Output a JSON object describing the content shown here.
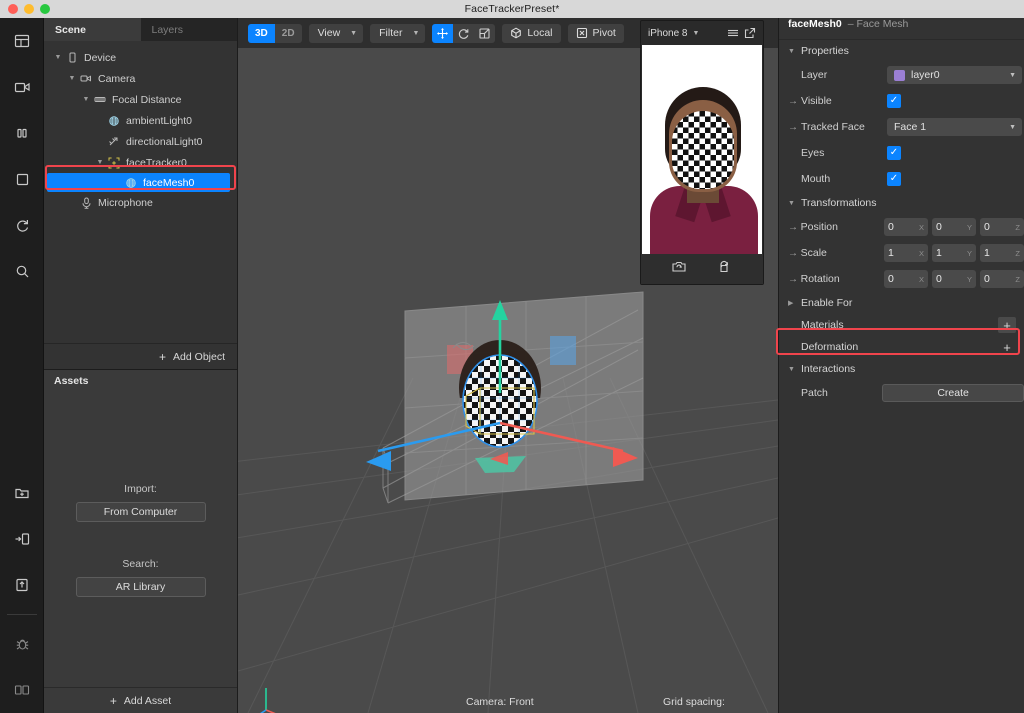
{
  "window": {
    "title": "FaceTrackerPreset*"
  },
  "rail": {
    "top": [
      {
        "icon": "layout-icon",
        "name": "rail-layout"
      },
      {
        "icon": "video-camera-icon",
        "name": "rail-video"
      },
      {
        "icon": "pause-icon",
        "name": "rail-pause"
      },
      {
        "icon": "stop-square-icon",
        "name": "rail-stop"
      },
      {
        "icon": "refresh-icon",
        "name": "rail-refresh"
      },
      {
        "icon": "search-icon",
        "name": "rail-search"
      }
    ],
    "bottom": [
      {
        "icon": "folder-plus-icon",
        "name": "rail-new-folder"
      },
      {
        "icon": "send-to-device-icon",
        "name": "rail-send-device"
      },
      {
        "icon": "upload-icon",
        "name": "rail-upload"
      },
      {
        "icon": "bug-icon",
        "name": "rail-debug"
      },
      {
        "icon": "panels-icon",
        "name": "rail-panels"
      }
    ]
  },
  "scene_panel": {
    "tabs": [
      {
        "label": "Scene",
        "active": true
      },
      {
        "label": "Layers",
        "active": false
      }
    ],
    "tree": [
      {
        "label": "Device",
        "depth": 0,
        "twist": "down",
        "icon": "device-icon",
        "selected": false
      },
      {
        "label": "Camera",
        "depth": 1,
        "twist": "down",
        "icon": "camera-icon",
        "selected": false
      },
      {
        "label": "Focal Distance",
        "depth": 2,
        "twist": "down",
        "icon": "focal-icon",
        "selected": false
      },
      {
        "label": "ambientLight0",
        "depth": 3,
        "twist": "",
        "icon": "ambient-light-icon",
        "selected": false
      },
      {
        "label": "directionalLight0",
        "depth": 3,
        "twist": "",
        "icon": "directional-light-icon",
        "selected": false
      },
      {
        "label": "faceTracker0",
        "depth": 3,
        "twist": "down",
        "icon": "face-tracker-icon",
        "selected": false
      },
      {
        "label": "faceMesh0",
        "depth": 4,
        "twist": "",
        "icon": "face-mesh-icon",
        "selected": true
      },
      {
        "label": "Microphone",
        "depth": 1,
        "twist": "",
        "icon": "microphone-icon",
        "selected": false
      }
    ],
    "add_object": "Add Object",
    "assets": {
      "title": "Assets",
      "import_label": "Import:",
      "import_button": "From Computer",
      "search_label": "Search:",
      "search_button": "AR Library",
      "add_asset": "Add Asset"
    }
  },
  "viewport": {
    "toolbar": {
      "mode_3d": "3D",
      "mode_2d": "2D",
      "view": "View",
      "filter": "Filter",
      "local": "Local",
      "pivot": "Pivot",
      "tools": [
        "move-tool-icon",
        "rotate-tool-icon",
        "scale-tool-icon"
      ]
    },
    "status": {
      "camera": "Camera: Front",
      "grid": "Grid spacing:"
    }
  },
  "preview": {
    "device": "iPhone 8",
    "menu_icon": "hamburger-icon",
    "popout_icon": "external-link-icon",
    "foot": [
      "camera-flip-icon",
      "record-rotate-icon"
    ]
  },
  "inspector": {
    "object_name": "faceMesh0",
    "object_type": "– Face Mesh",
    "sections": {
      "properties": "Properties",
      "transformations": "Transformations",
      "enable_for": "Enable For",
      "materials": "Materials",
      "deformation": "Deformation",
      "interactions": "Interactions"
    },
    "properties": {
      "layer_label": "Layer",
      "layer_value": "layer0",
      "layer_color": "#9b7fd4",
      "visible_label": "Visible",
      "visible_checked": true,
      "tracked_face_label": "Tracked Face",
      "tracked_face_value": "Face 1",
      "eyes_label": "Eyes",
      "eyes_checked": true,
      "mouth_label": "Mouth",
      "mouth_checked": true
    },
    "transformations": {
      "position_label": "Position",
      "position": [
        "0",
        "0",
        "0"
      ],
      "scale_label": "Scale",
      "scale": [
        "1",
        "1",
        "1"
      ],
      "rotation_label": "Rotation",
      "rotation": [
        "0",
        "0",
        "0"
      ],
      "axes": [
        "X",
        "Y",
        "Z"
      ]
    },
    "interactions": {
      "patch_label": "Patch",
      "create_button": "Create"
    },
    "highlight_color": "#f0444c",
    "accent_color": "#0b84ff"
  }
}
